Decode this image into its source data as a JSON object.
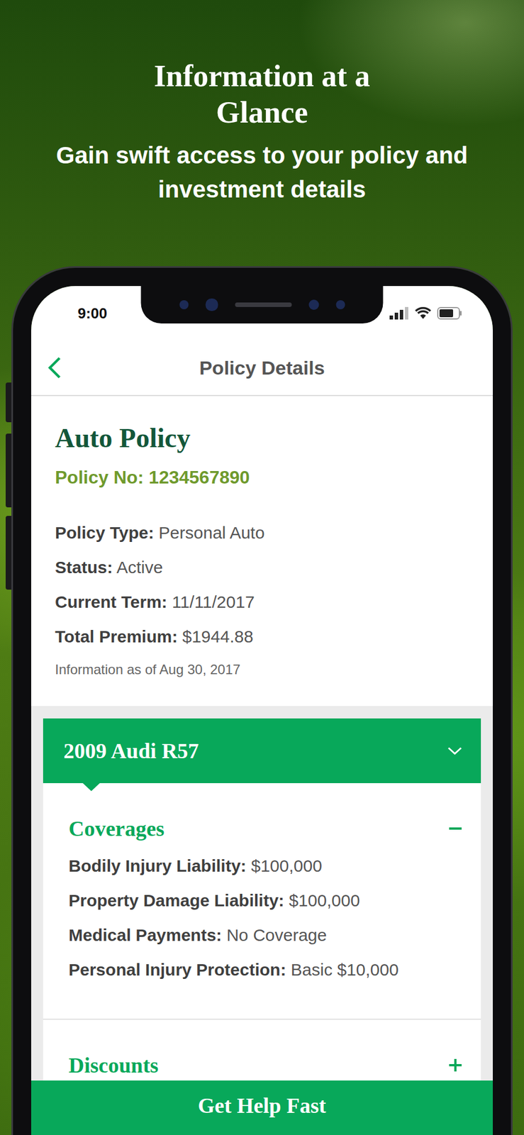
{
  "promo": {
    "title": "Information at a Glance",
    "subtitle": "Gain swift access to your policy and investment details"
  },
  "status_bar": {
    "time": "9:00"
  },
  "nav": {
    "title": "Policy Details"
  },
  "policy": {
    "title": "Auto Policy",
    "number_label": "Policy No:",
    "number": "1234567890",
    "fields": [
      {
        "label": "Policy Type:",
        "value": "Personal Auto"
      },
      {
        "label": "Status:",
        "value": "Active"
      },
      {
        "label": "Current Term:",
        "value": "11/11/2017"
      },
      {
        "label": "Total Premium:",
        "value": "$1944.88"
      }
    ],
    "as_of": "Information as of Aug 30, 2017"
  },
  "vehicle": {
    "name": "2009 Audi R57",
    "expanded": true,
    "sections": [
      {
        "title": "Coverages",
        "expanded": true,
        "items": [
          {
            "label": "Bodily Injury Liability:",
            "value": "$100,000"
          },
          {
            "label": "Property Damage Liability:",
            "value": "$100,000"
          },
          {
            "label": "Medical Payments:",
            "value": "No Coverage"
          },
          {
            "label": "Personal Injury Protection:",
            "value": "Basic $10,000"
          }
        ]
      },
      {
        "title": "Discounts",
        "expanded": false,
        "items": []
      }
    ]
  },
  "help_button": {
    "label": "Get Help Fast"
  }
}
